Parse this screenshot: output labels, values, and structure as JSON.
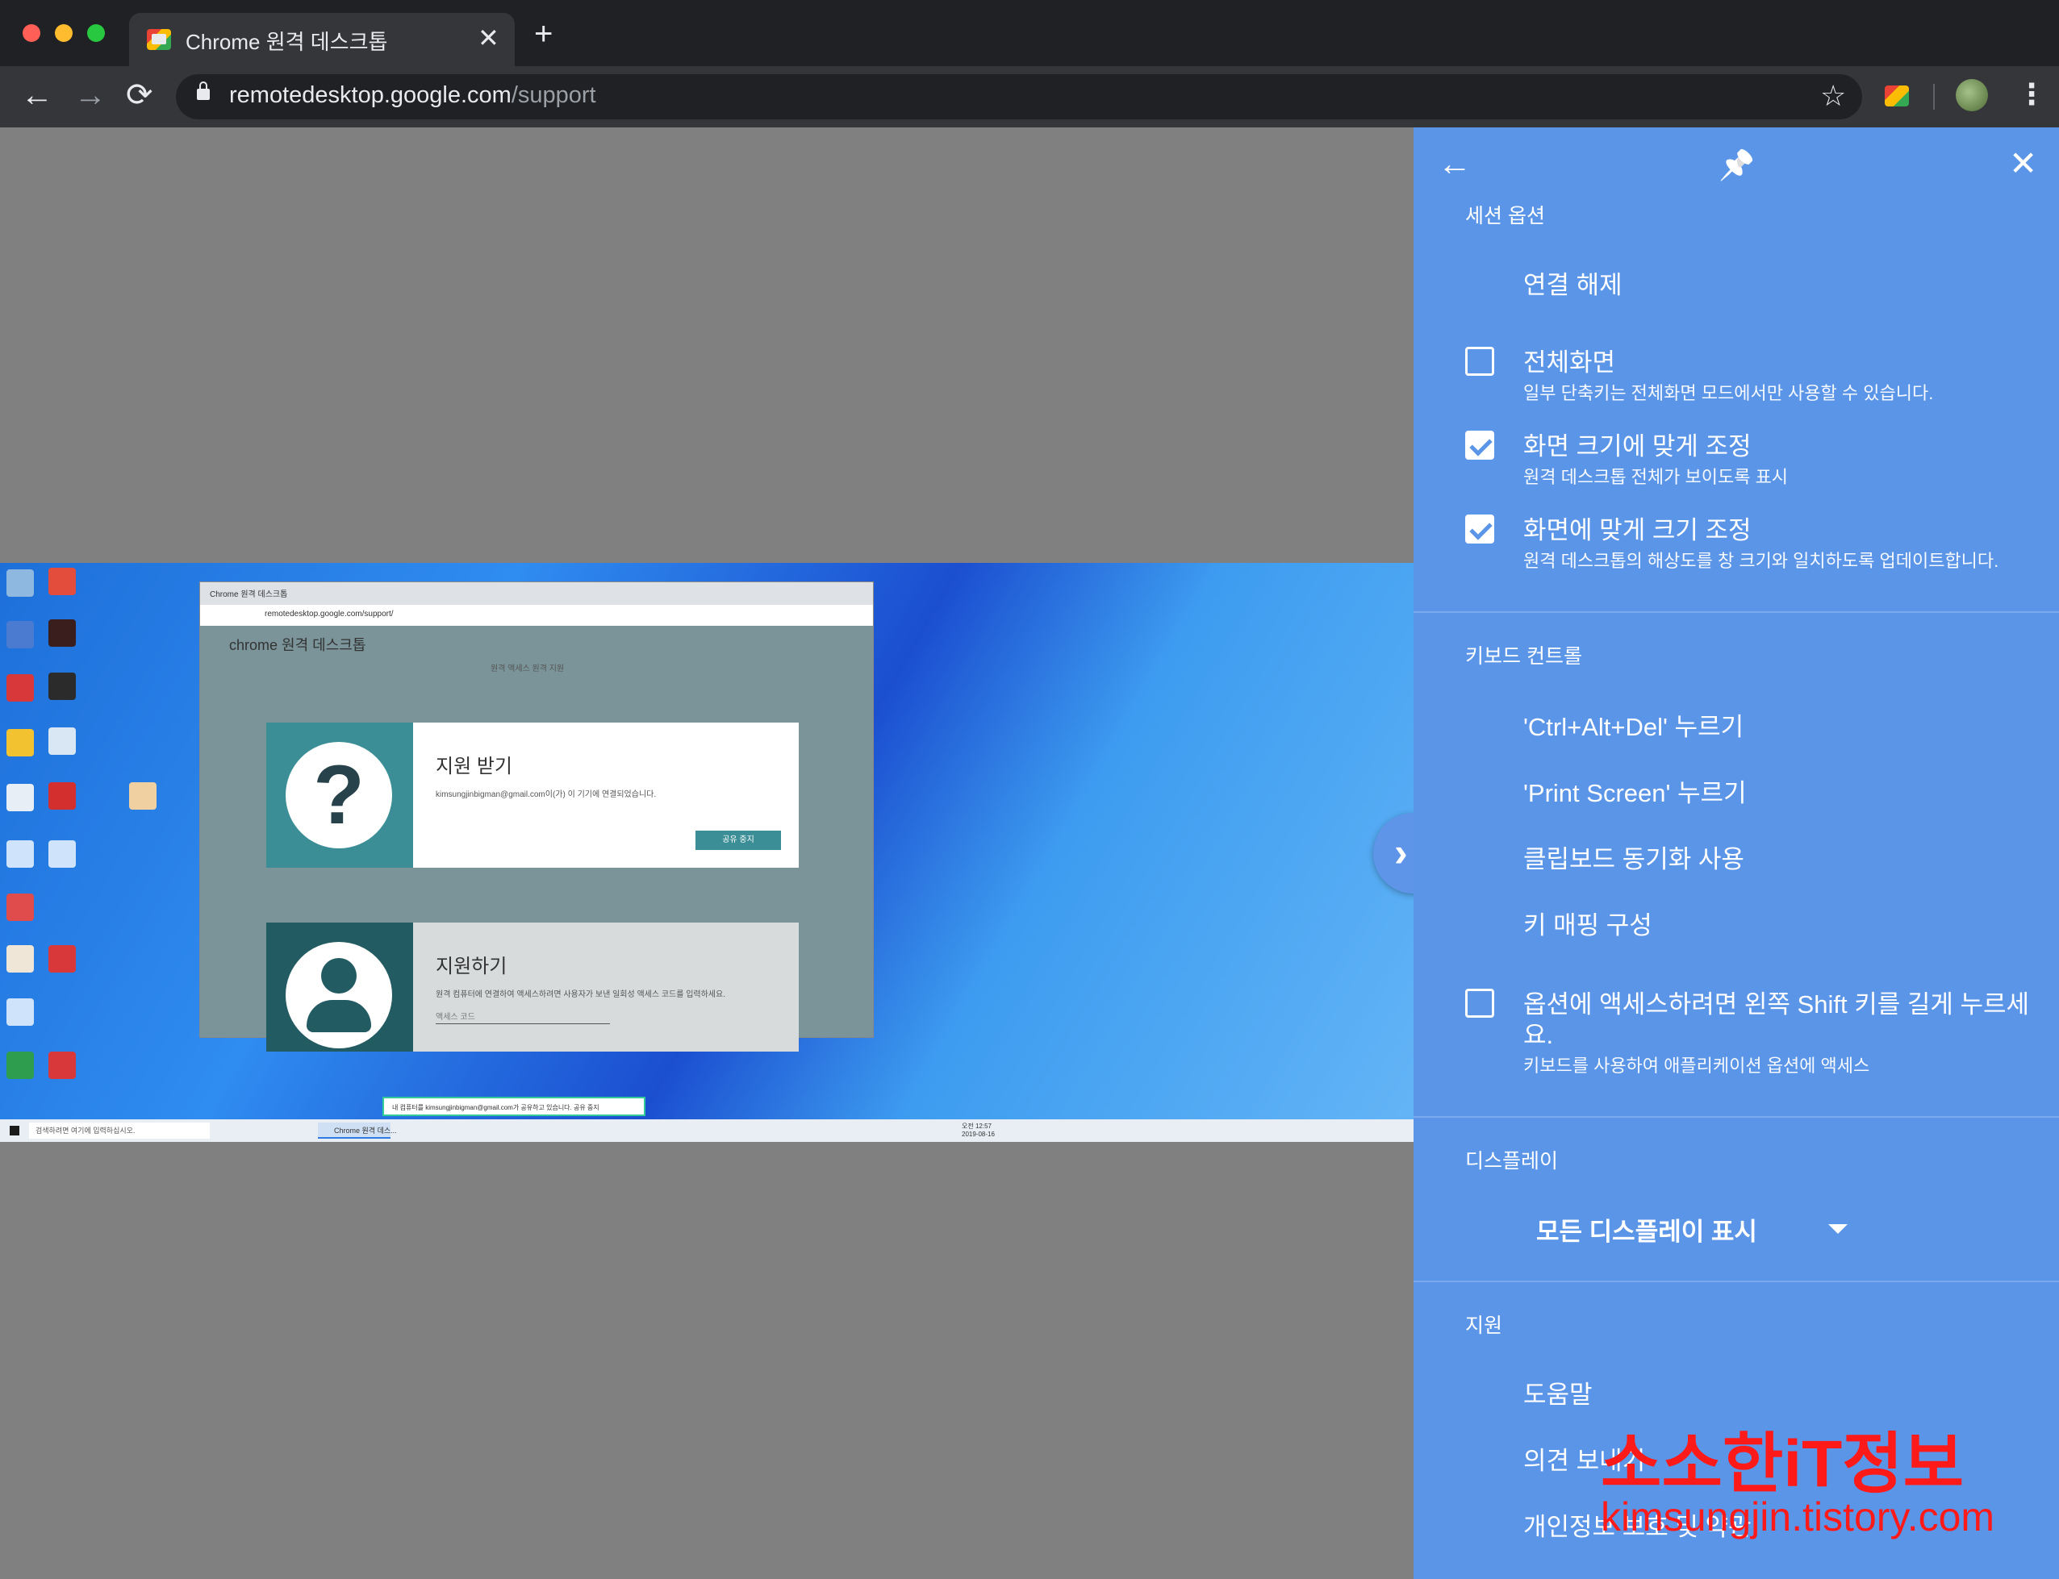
{
  "window": {
    "tab_title": "Chrome 원격 데스크톱",
    "tab_close": "✕",
    "new_tab": "+"
  },
  "toolbar": {
    "back": "←",
    "forward": "→",
    "reload": "⟳",
    "url_host": "remotedesktop.google.com",
    "url_path": "/support",
    "bookmark_icon": "star-icon",
    "menu": "⋮"
  },
  "remote": {
    "browser_tab": "Chrome 원격 데스크톱",
    "browser_url": "remotedesktop.google.com/support/",
    "page_heading": "chrome 원격 데스크톱",
    "page_nav": "원격 액세스    원격 지원",
    "card1_title": "지원 받기",
    "card1_sub": "kimsungjinbigman@gmail.com이(가) 이 기기에 연결되었습니다.",
    "card1_button": "공유 중지",
    "card2_title": "지원하기",
    "card2_sub": "원격 컴퓨터에 연결하여 액세스하려면 사용자가 보낸 일회성 액세스 코드를 입력하세요.",
    "card2_code": "액세스 코드",
    "share_bar": "내 컴퓨터를 kimsungjinbigman@gmail.com가 공유하고 있습니다.    공유 중지",
    "taskbar_search": "검색하려면 여기에 입력하십시오.",
    "taskbar_chrome": "Chrome 원격 데스...",
    "taskbar_clock": "오전 12:57\n2019-08-16"
  },
  "toggle": "›",
  "panel": {
    "back_icon": "←",
    "pin_icon": "📌",
    "close_icon": "✕",
    "session_header": "세션 옵션",
    "disconnect": "연결 해제",
    "fullscreen": {
      "label": "전체화면",
      "sub": "일부 단축키는 전체화면 모드에서만 사용할 수 있습니다.",
      "checked": false
    },
    "fit_window": {
      "label": "화면 크기에 맞게 조정",
      "sub": "원격 데스크톱 전체가 보이도록 표시",
      "checked": true
    },
    "resize_remote": {
      "label": "화면에 맞게 크기 조정",
      "sub": "원격 데스크톱의 해상도를 창 크기와 일치하도록 업데이트합니다.",
      "checked": true
    },
    "keyboard_header": "키보드 컨트롤",
    "ctrl_alt_del": "'Ctrl+Alt+Del' 누르기",
    "print_screen": "'Print Screen' 누르기",
    "clipboard": "클립보드 동기화 사용",
    "keymap": "키 매핑 구성",
    "shift_option": {
      "label_line1": "옵션에 액세스하려면 왼쪽 Shift 키를 길게 누르세",
      "label_line2": "요.",
      "sub": "키보드를 사용하여 애플리케이션 옵션에 액세스",
      "checked": false
    },
    "display_header": "디스플레이",
    "display_select": "모든 디스플레이 표시",
    "support_header": "지원",
    "help": "도움말",
    "feedback": "의견 보내기",
    "privacy": "개인정보 보호 및 약관"
  },
  "watermark": {
    "line1": "소소한iT정보",
    "line2": "kimsungjin.tistory.com"
  },
  "colors": {
    "panel_bg": "#5b95e8",
    "chrome_dark": "#202124",
    "toolbar": "#35363a"
  }
}
